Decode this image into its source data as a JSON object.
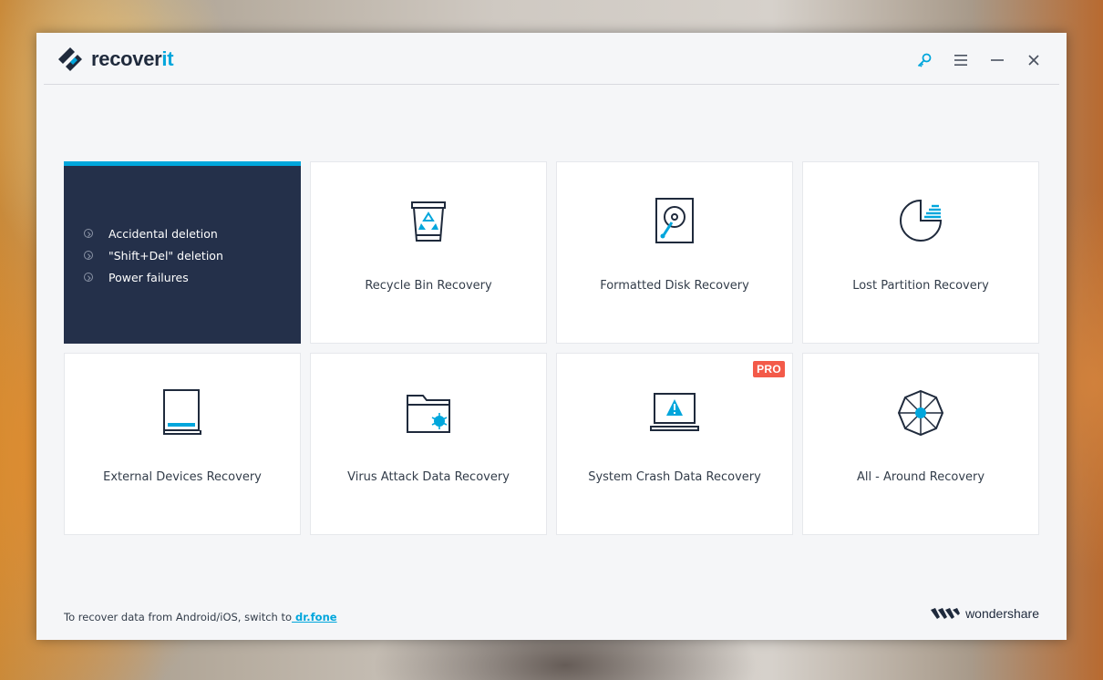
{
  "app": {
    "name_main": "recover",
    "name_accent": "it"
  },
  "window_controls": {
    "register_icon": "key-icon",
    "menu_icon": "hamburger-menu-icon",
    "minimize_icon": "minimize-icon",
    "close_icon": "close-icon"
  },
  "feature_card": {
    "items": [
      "Accidental deletion",
      "\"Shift+Del\" deletion",
      "Power failures"
    ]
  },
  "cards": [
    {
      "label": "Recycle Bin Recovery",
      "icon": "recycle-bin-icon"
    },
    {
      "label": "Formatted Disk Recovery",
      "icon": "hard-disk-icon"
    },
    {
      "label": "Lost Partition Recovery",
      "icon": "partition-pie-icon"
    },
    {
      "label": "External Devices Recovery",
      "icon": "external-device-icon"
    },
    {
      "label": "Virus Attack Data Recovery",
      "icon": "virus-folder-icon"
    },
    {
      "label": "System Crash Data Recovery",
      "icon": "crashed-laptop-icon",
      "badge": "PRO"
    },
    {
      "label": "All - Around Recovery",
      "icon": "all-around-web-icon"
    }
  ],
  "footer": {
    "note": "To recover data from Android/iOS, switch to",
    "link": " dr.fone",
    "brand": "wondershare"
  },
  "colors": {
    "accent": "#00a6dc",
    "dark_card": "#24304a",
    "pro_badge": "#f35a49",
    "icon_dark": "#1f2a3c"
  }
}
